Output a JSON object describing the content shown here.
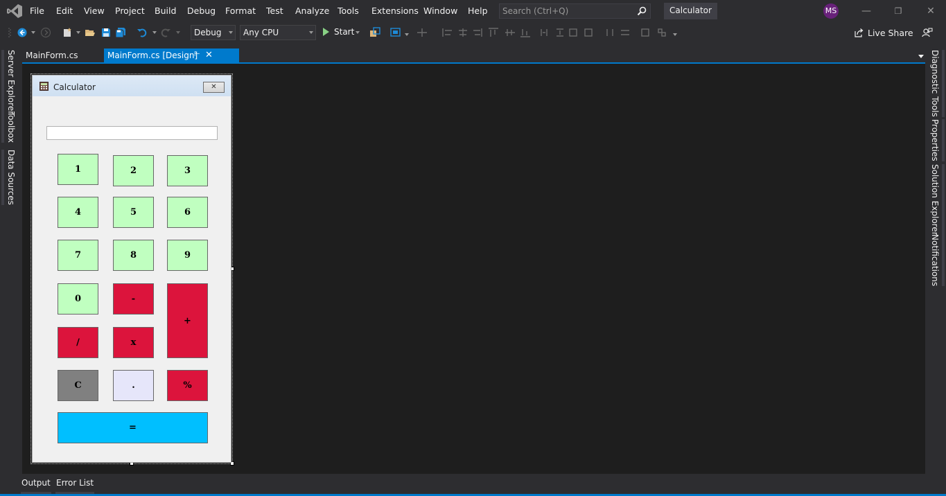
{
  "menu": {
    "items": [
      "File",
      "Edit",
      "View",
      "Project",
      "Build",
      "Debug",
      "Format",
      "Test",
      "Analyze",
      "Tools",
      "Extensions",
      "Window",
      "Help"
    ]
  },
  "search": {
    "placeholder": "Search (Ctrl+Q)"
  },
  "app_title": "Calculator",
  "user_initials": "MS",
  "toolbar": {
    "configuration": "Debug",
    "platform": "Any CPU",
    "start_label": "Start",
    "live_share_label": "Live Share"
  },
  "left_panels": [
    "Server Explorer",
    "Toolbox",
    "Data Sources"
  ],
  "right_panels": [
    "Diagnostic Tools",
    "Properties",
    "Solution Explorer",
    "Notifications"
  ],
  "doc_tabs": [
    {
      "label": "MainForm.cs",
      "active": false
    },
    {
      "label": "MainForm.cs [Design]",
      "active": true
    }
  ],
  "form": {
    "title": "Calculator",
    "close_glyph": "✕",
    "display_value": "",
    "buttons": {
      "b1": "1",
      "b2": "2",
      "b3": "3",
      "b4": "4",
      "b5": "5",
      "b6": "6",
      "b7": "7",
      "b8": "8",
      "b9": "9",
      "b0": "0",
      "minus": "-",
      "plus": "+",
      "divide": "/",
      "multiply": "x",
      "clear": "C",
      "dot": ".",
      "percent": "%",
      "equals": "="
    }
  },
  "bottom_tabs": [
    "Output",
    "Error List"
  ],
  "colors": {
    "accent": "#007acc",
    "number_button": "#c0ffc0",
    "operator_button": "#dc143c",
    "clear_button": "#808080",
    "dot_button": "#e6e6fa",
    "equals_button": "#00bfff"
  }
}
